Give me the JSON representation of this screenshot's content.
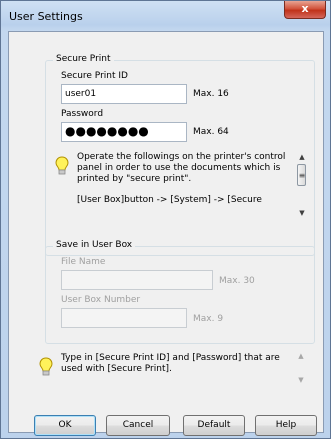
{
  "window": {
    "title": "User Settings",
    "close_glyph": "x"
  },
  "secure_print": {
    "group_title": "Secure Print",
    "id_label": "Secure Print ID",
    "id_value": "user01",
    "id_max": "Max. 16",
    "password_label": "Password",
    "password_value": "●●●●●●●●",
    "password_max": "Max. 64",
    "info_lines": [
      "Operate the followings on the printer's control",
      "panel in order to use the documents which is",
      "printed by \"secure print\".",
      "[User Box]button -> [System] -> [Secure"
    ]
  },
  "user_box": {
    "group_title": "Save in User Box",
    "file_name_label": "File Name",
    "file_name_max": "Max. 30",
    "number_label": "User Box Number",
    "number_max": "Max. 9"
  },
  "help_text": [
    "Type in [Secure Print ID] and [Password] that are",
    "used with [Secure Print]."
  ],
  "buttons": {
    "ok": "OK",
    "cancel": "Cancel",
    "default": "Default",
    "help": "Help"
  },
  "icons": {
    "bulb": "lightbulb-icon",
    "scroll_up": "▲",
    "scroll_down": "▼",
    "grip": "≡"
  }
}
